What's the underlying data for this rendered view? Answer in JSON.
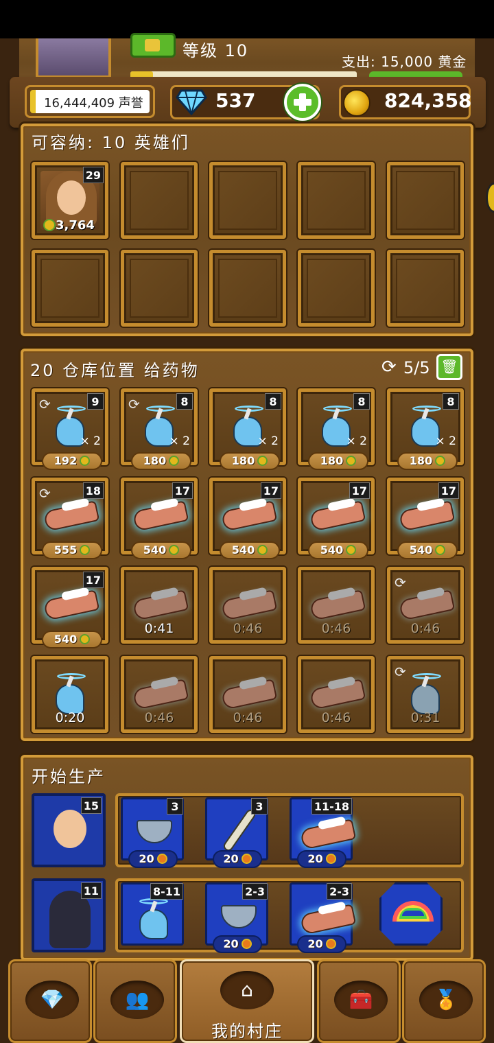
{
  "header": {
    "level_label": "等级 10",
    "cost_label": "支出: 15,000 黄金",
    "xp_fraction": 0.1
  },
  "currency": {
    "reputation": "16,444,409 声誉",
    "gems": "537",
    "gold": "824,358"
  },
  "heroes_panel": {
    "title": "可容纳: 10 英雄们",
    "hero": {
      "level": "29",
      "price": "3,764"
    }
  },
  "storage_panel": {
    "title": "20 仓库位置 给药物",
    "counter": "5/5",
    "rows": [
      [
        {
          "type": "unicorn",
          "level": "9",
          "count": "× 2",
          "price": "192",
          "refresh": true
        },
        {
          "type": "unicorn",
          "level": "8",
          "count": "× 2",
          "price": "180",
          "refresh": true
        },
        {
          "type": "unicorn",
          "level": "8",
          "count": "× 2",
          "price": "180",
          "refresh": false
        },
        {
          "type": "unicorn",
          "level": "8",
          "count": "× 2",
          "price": "180",
          "refresh": false
        },
        {
          "type": "unicorn",
          "level": "8",
          "count": "× 2",
          "price": "180",
          "refresh": false
        }
      ],
      [
        {
          "type": "arm",
          "level": "18",
          "price": "555",
          "refresh": true
        },
        {
          "type": "arm",
          "level": "17",
          "price": "540",
          "refresh": false
        },
        {
          "type": "arm",
          "level": "17",
          "price": "540",
          "refresh": false
        },
        {
          "type": "arm",
          "level": "17",
          "price": "540",
          "refresh": false
        },
        {
          "type": "arm",
          "level": "17",
          "price": "540",
          "refresh": false
        }
      ],
      [
        {
          "type": "arm",
          "level": "17",
          "price": "540",
          "refresh": false
        },
        {
          "type": "arm-grey",
          "timer": "0:41",
          "refresh": false
        },
        {
          "type": "arm-grey",
          "timer": "0:46",
          "dim": true,
          "refresh": false
        },
        {
          "type": "arm-grey",
          "timer": "0:46",
          "dim": true,
          "refresh": false
        },
        {
          "type": "arm-grey",
          "timer": "0:46",
          "dim": true,
          "refresh": true
        }
      ],
      [
        {
          "type": "unicorn",
          "timer": "0:20",
          "refresh": false
        },
        {
          "type": "arm-grey",
          "timer": "0:46",
          "dim": true,
          "refresh": false
        },
        {
          "type": "arm-grey",
          "timer": "0:46",
          "dim": true,
          "refresh": false
        },
        {
          "type": "arm-grey",
          "timer": "0:46",
          "dim": true,
          "refresh": false
        },
        {
          "type": "unicorn-grey",
          "timer": "0:31",
          "dim": true,
          "refresh": true
        }
      ]
    ]
  },
  "production_panel": {
    "title": "开始生产",
    "crafters": [
      {
        "level": "15",
        "recipes": [
          {
            "icon": "mortar",
            "level": "3",
            "price": "20"
          },
          {
            "icon": "bone",
            "level": "3",
            "price": "20"
          },
          {
            "icon": "arm",
            "level": "11-18",
            "price": "20"
          }
        ]
      },
      {
        "level": "11",
        "recipes": [
          {
            "icon": "unicorn",
            "level": "8-11"
          },
          {
            "icon": "mortar",
            "level": "2-3",
            "price": "20"
          },
          {
            "icon": "arm",
            "level": "2-3",
            "price": "20"
          },
          {
            "icon": "rainbow"
          }
        ]
      }
    ]
  },
  "nav": {
    "active_label": "我的村庄"
  }
}
